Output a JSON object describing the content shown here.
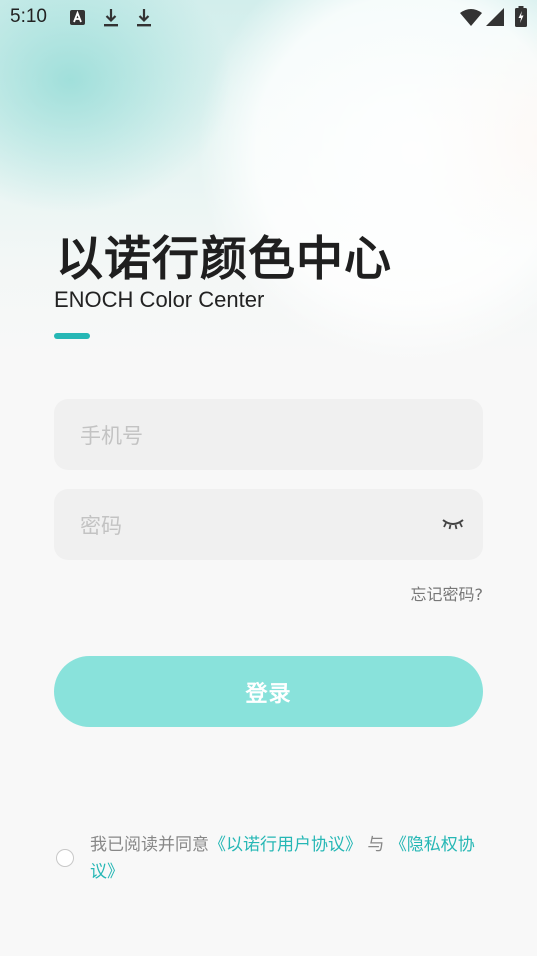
{
  "status_bar": {
    "time": "5:10",
    "left_icons": [
      "a-notification-icon",
      "download-icon",
      "download-icon"
    ],
    "right_icons": [
      "wifi-icon",
      "cellular-signal-icon",
      "battery-charging-icon"
    ]
  },
  "header": {
    "title": "以诺行颜色中心",
    "subtitle": "ENOCH Color Center"
  },
  "form": {
    "phone_placeholder": "手机号",
    "phone_value": "",
    "password_placeholder": "密码",
    "password_value": "",
    "forgot_label": "忘记密码?",
    "login_label": "登录"
  },
  "agreement": {
    "checked": false,
    "prefix": "我已阅读并同意",
    "user_agreement": "《以诺行用户协议》",
    "connector": "与",
    "privacy_agreement": "《隐私权协议》"
  },
  "colors": {
    "accent": "#26b7b5",
    "button": "#89e2db"
  }
}
